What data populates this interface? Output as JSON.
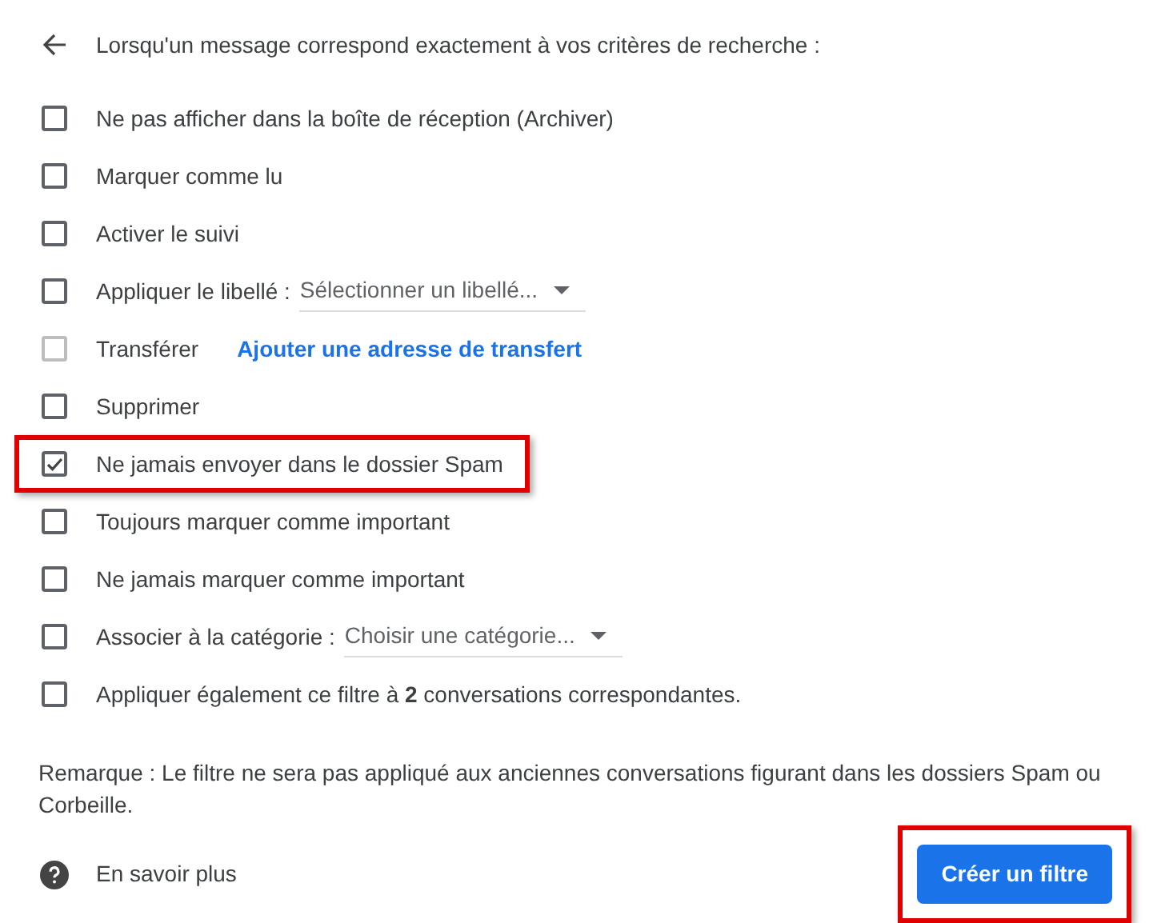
{
  "header": {
    "title": "Lorsqu'un message correspond exactement à vos critères de recherche :"
  },
  "options": [
    {
      "kind": "plain",
      "label": "Ne pas afficher dans la boîte de réception (Archiver)",
      "checked": false,
      "disabled": false,
      "highlighted": false
    },
    {
      "kind": "plain",
      "label": "Marquer comme lu",
      "checked": false,
      "disabled": false,
      "highlighted": false
    },
    {
      "kind": "plain",
      "label": "Activer le suivi",
      "checked": false,
      "disabled": false,
      "highlighted": false
    },
    {
      "kind": "select",
      "label": "Appliquer le libellé :",
      "select": "Sélectionner un libellé...",
      "checked": false,
      "disabled": false,
      "highlighted": false
    },
    {
      "kind": "link",
      "label": "Transférer",
      "link": "Ajouter une adresse de transfert",
      "checked": false,
      "disabled": true,
      "highlighted": false
    },
    {
      "kind": "plain",
      "label": "Supprimer",
      "checked": false,
      "disabled": false,
      "highlighted": false
    },
    {
      "kind": "plain",
      "label": "Ne jamais envoyer dans le dossier Spam",
      "checked": true,
      "disabled": false,
      "highlighted": true
    },
    {
      "kind": "plain",
      "label": "Toujours marquer comme important",
      "checked": false,
      "disabled": false,
      "highlighted": false
    },
    {
      "kind": "plain",
      "label": "Ne jamais marquer comme important",
      "checked": false,
      "disabled": false,
      "highlighted": false
    },
    {
      "kind": "select",
      "label": "Associer à la catégorie :",
      "select": "Choisir une catégorie...",
      "checked": false,
      "disabled": false,
      "highlighted": false
    },
    {
      "kind": "plain",
      "label": "Appliquer également ce filtre à **2** conversations correspondantes.",
      "checked": false,
      "disabled": false,
      "highlighted": false
    }
  ],
  "note": "Remarque : Le filtre ne sera pas appliqué aux anciennes conversations figurant dans les dossiers Spam ou Corbeille.",
  "help_link": "En savoir plus",
  "create_button": {
    "label": "Créer un filtre",
    "highlighted": true
  }
}
